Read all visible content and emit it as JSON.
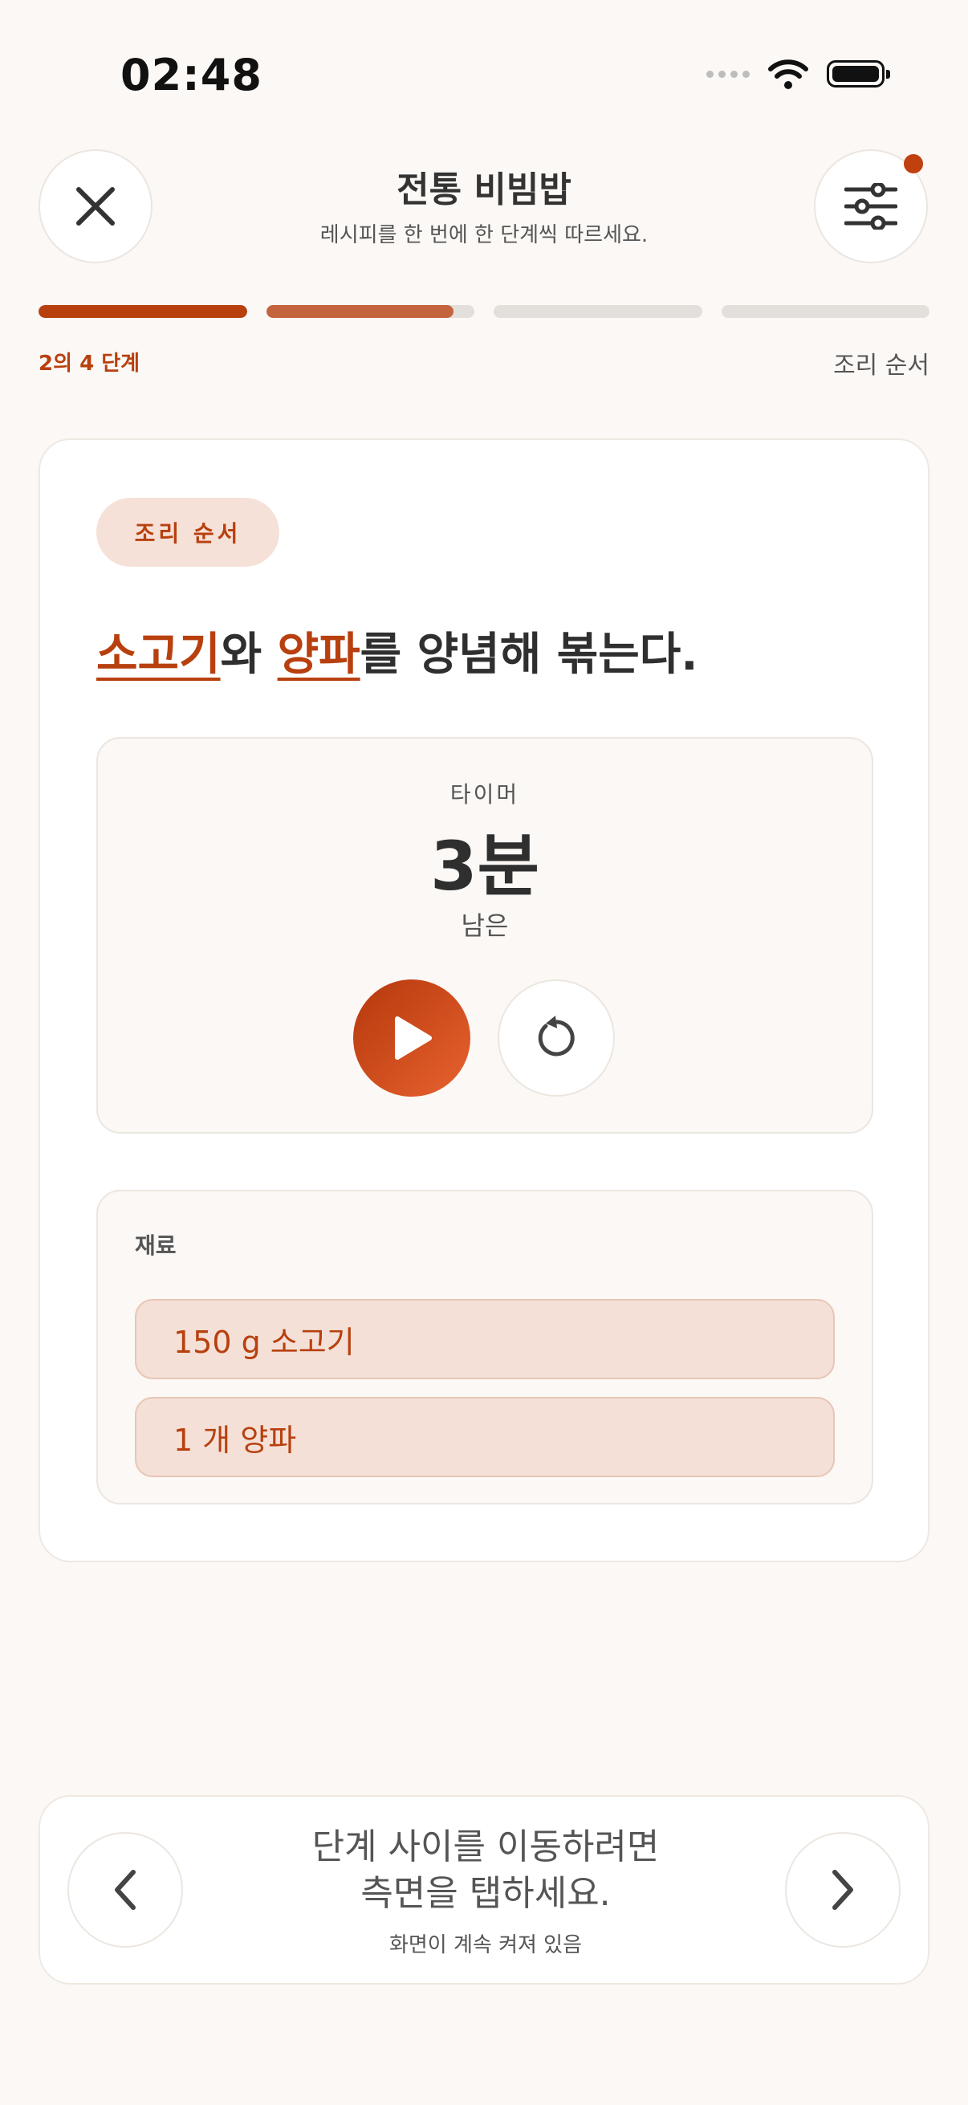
{
  "status_bar": {
    "time": "02:48"
  },
  "header": {
    "title": "전통 비빔밥",
    "subtitle": "레시피를 한 번에 한 단계씩 따르세요."
  },
  "progress": {
    "step_label": "2의 4 단계",
    "section_label": "조리 순서",
    "segments": [
      1.0,
      0.9,
      0.0,
      0.0
    ]
  },
  "step": {
    "chip": "조리 순서",
    "instruction": {
      "part1": "소고기",
      "part2": "와 ",
      "part3": "양파",
      "part4": "를 양념해 볶는다."
    }
  },
  "timer": {
    "label": "타이머",
    "value": "3분",
    "remaining": "남은"
  },
  "ingredients": {
    "title": "재료",
    "items": [
      {
        "label": "150 g 소고기"
      },
      {
        "label": "1 개 양파"
      }
    ]
  },
  "bottom_nav": {
    "hint_line1": "단계 사이를 이동하려면",
    "hint_line2": "측면을 탭하세요.",
    "screen_note": "화면이 계속 켜져 있음"
  },
  "colors": {
    "accent": "#b8400f",
    "accent_light": "#c4643f",
    "background": "#fbf8f5"
  },
  "icons": {
    "close": "close-icon",
    "filter": "sliders-icon",
    "play": "play-icon",
    "reset": "reset-icon",
    "prev": "chevron-left-icon",
    "next": "chevron-right-icon"
  }
}
